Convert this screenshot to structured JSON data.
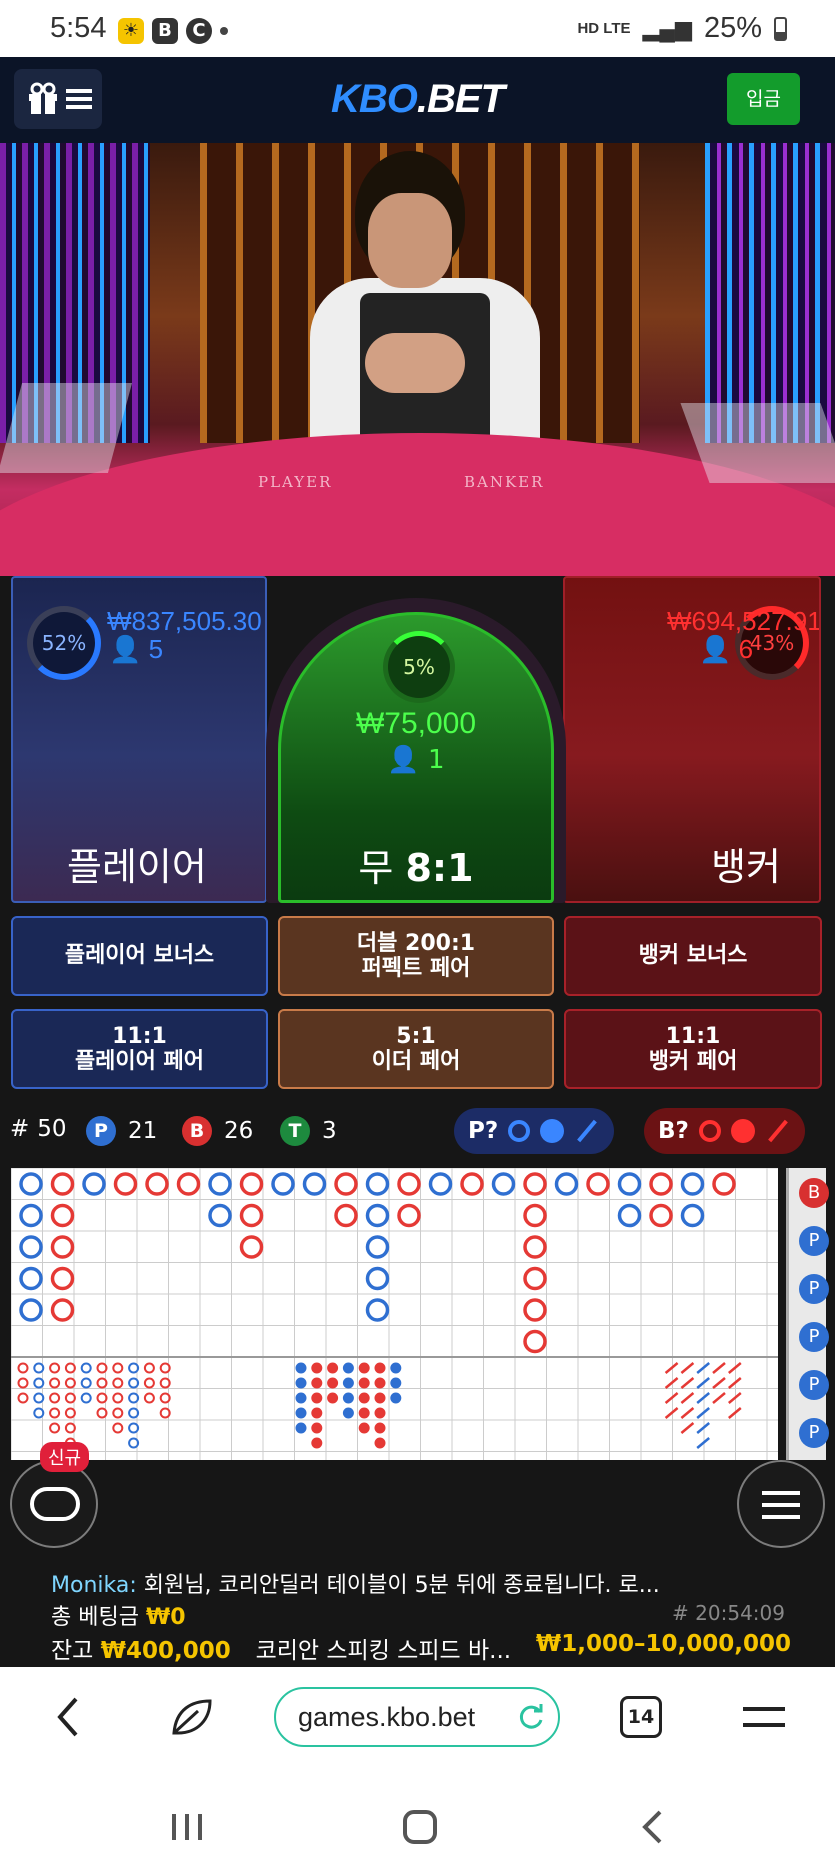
{
  "status_bar": {
    "time": "5:54",
    "battery": "25%",
    "network": "HD LTE"
  },
  "header": {
    "logo_primary": "KBO",
    "logo_secondary": ".BET",
    "deposit_label": "입금"
  },
  "video": {
    "table_player_text": "PLAYER",
    "table_banker_text": "BANKER"
  },
  "player": {
    "percent": "52%",
    "amount": "₩837,505.30",
    "count": "5",
    "label": "플레이어",
    "color": "#2979ff"
  },
  "tie": {
    "percent": "5%",
    "amount": "₩75,000",
    "count": "1",
    "label_prefix": "무",
    "label_odds": "8:1"
  },
  "banker": {
    "percent": "43%",
    "amount": "₩694,527.91",
    "count": "6",
    "label": "뱅커",
    "color": "#ff2a2a"
  },
  "side_bets": {
    "player_bonus": "플레이어 보너스",
    "double_perfect_1": "더블 200:1",
    "double_perfect_2": "퍼펙트 페어",
    "banker_bonus": "뱅커 보너스",
    "player_pair_1": "11:1",
    "player_pair_2": "플레이어 페어",
    "either_pair_1": "5:1",
    "either_pair_2": "이더 페어",
    "banker_pair_1": "11:1",
    "banker_pair_2": "뱅커 페어"
  },
  "stats": {
    "round_label": "#",
    "round": "50",
    "p_label": "P",
    "p_count": "21",
    "b_label": "B",
    "b_count": "26",
    "t_label": "T",
    "t_count": "3"
  },
  "predict": {
    "player_label": "P?",
    "banker_label": "B?"
  },
  "road_side": [
    "B",
    "P",
    "P",
    "P",
    "P",
    "P"
  ],
  "chat": {
    "user": "Monika:",
    "message": "회원님, 코리안딜러 테이블이 5분 뒤에 종료됩니다. 로...",
    "new_badge": "신규"
  },
  "footer": {
    "total_bet_label": "총 베팅금",
    "total_bet_value": "₩0",
    "round_id": "# 20:54:09",
    "balance_label": "잔고",
    "balance_value": "₩400,000",
    "table_name": "코리안 스피킹 스피드 바...",
    "limits": "₩1,000–10,000,000"
  },
  "browser": {
    "url": "games.kbo.bet",
    "tab_count": "14"
  }
}
